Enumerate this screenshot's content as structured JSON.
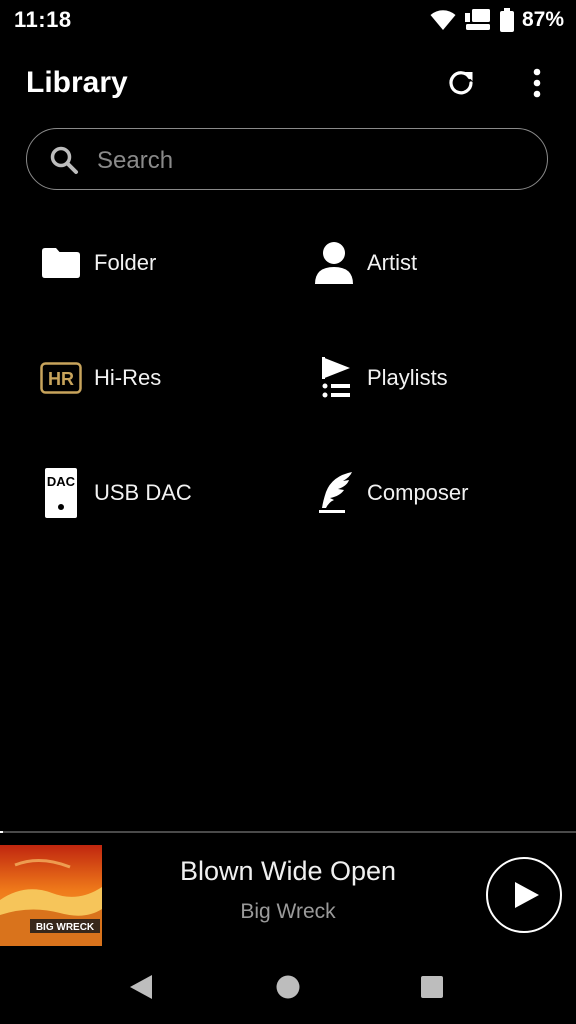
{
  "status": {
    "time": "11:18",
    "battery": "87%"
  },
  "header": {
    "title": "Library"
  },
  "search": {
    "placeholder": "Search"
  },
  "categories": [
    {
      "label": "Folder",
      "icon": "folder-icon"
    },
    {
      "label": "Artist",
      "icon": "person-icon"
    },
    {
      "label": "Hi-Res",
      "icon": "hi-res-icon"
    },
    {
      "label": "Playlists",
      "icon": "playlist-icon"
    },
    {
      "label": "USB DAC",
      "icon": "usb-dac-icon"
    },
    {
      "label": "Composer",
      "icon": "quill-icon"
    }
  ],
  "icons": {
    "hires_text": "HR",
    "dac_text": "DAC"
  },
  "now_playing": {
    "title": "Blown Wide Open",
    "artist": "Big Wreck",
    "album_art_text": "BIG WRECK",
    "progress_fraction": 0.005
  },
  "colors": {
    "background": "#000000",
    "hires_gold": "#c8a45c",
    "divider": "#4a4a4a"
  }
}
